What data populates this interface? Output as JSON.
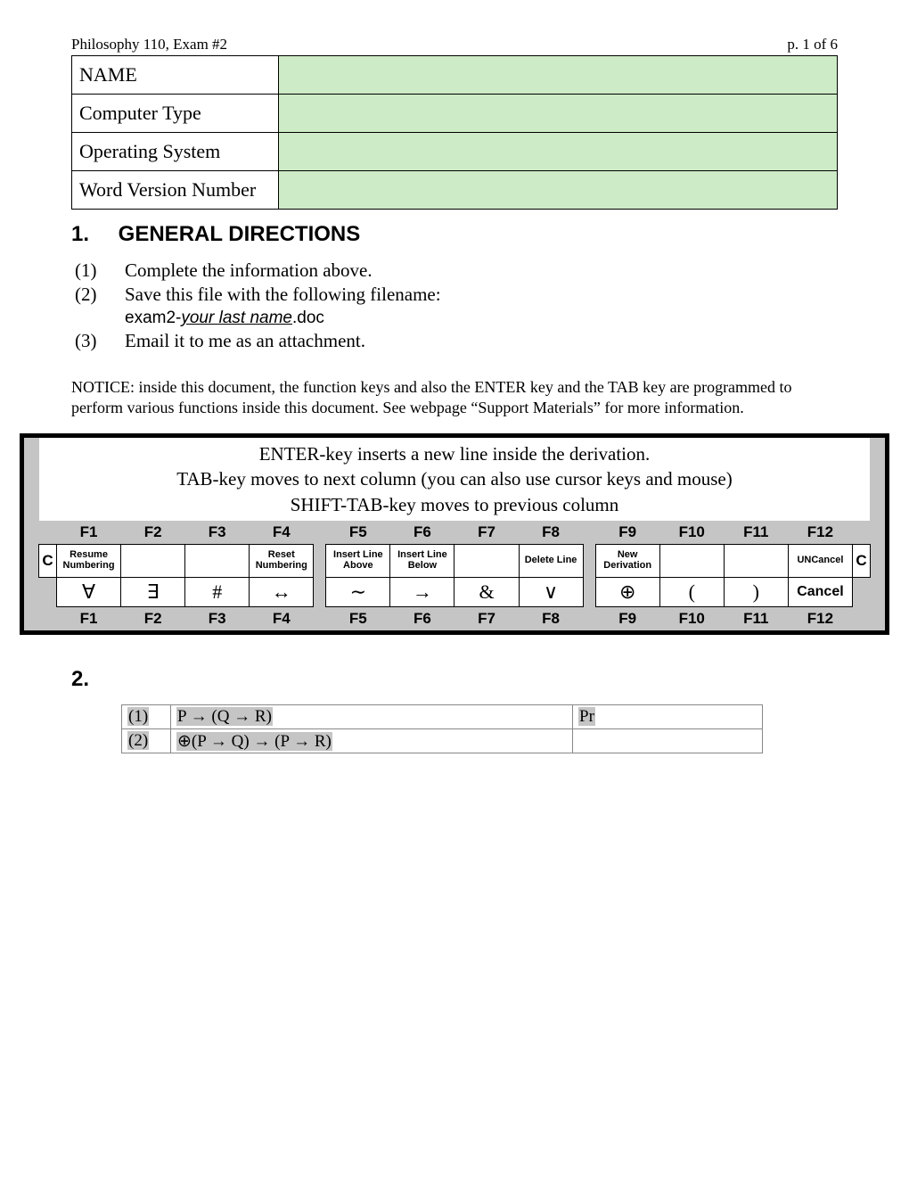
{
  "header": {
    "left": "Philosophy 110, Exam #2",
    "right": "p. 1 of 6"
  },
  "info_rows": [
    {
      "label": "NAME"
    },
    {
      "label": "Computer Type"
    },
    {
      "label": "Operating System"
    },
    {
      "label": "Word Version Number"
    }
  ],
  "section1": {
    "number": "1.",
    "title": "GENERAL DIRECTIONS",
    "items": [
      {
        "n": "(1)",
        "text": "Complete the information above."
      },
      {
        "n": "(2)",
        "text": "Save this file with the following filename:",
        "filename_prefix": "exam2-",
        "filename_var": "your last name",
        "filename_suffix": ".doc"
      },
      {
        "n": "(3)",
        "text": "Email it to me as an attachment."
      }
    ],
    "notice": "NOTICE: inside this document, the function keys and also the ENTER key and the TAB key are programmed to perform various functions inside this document.  See webpage “Support Materials” for more information."
  },
  "keyboard": {
    "banner1": "ENTER-key inserts a new line inside the derivation.",
    "banner2": "TAB-key moves to next column (you can also use cursor keys and mouse)",
    "banner3": "SHIFT-TAB-key moves to previous column",
    "fn": [
      "F1",
      "F2",
      "F3",
      "F4",
      "F5",
      "F6",
      "F7",
      "F8",
      "F9",
      "F10",
      "F11",
      "F12"
    ],
    "c_label": "C",
    "row_actions": [
      "Resume Numbering",
      "",
      "",
      "Reset Numbering",
      "Insert Line Above",
      "Insert Line Below",
      "",
      "Delete Line",
      "New Derivation",
      "",
      "",
      "UNCancel"
    ],
    "row_symbols": [
      "∀",
      "∃",
      "#",
      "↔",
      "∼",
      "→",
      "&",
      "∨",
      "⊕",
      "(",
      ")",
      "Cancel"
    ]
  },
  "section2": {
    "number": "2.",
    "rows": [
      {
        "n": "(1)",
        "formula": "P → (Q → R)",
        "just": "Pr"
      },
      {
        "n": "(2)",
        "formula": "⊕(P → Q) → (P → R)",
        "just": ""
      }
    ]
  }
}
